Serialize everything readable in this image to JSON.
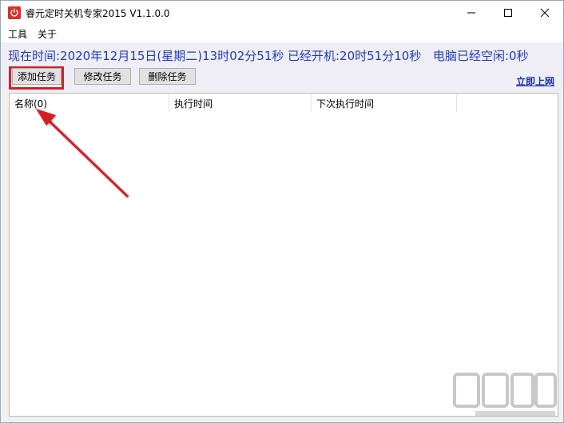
{
  "window": {
    "title": "睿元定时关机专家2015 V1.1.0.0",
    "controls": [
      "minimize-icon",
      "maximize-icon",
      "close-icon"
    ]
  },
  "menu": {
    "items": [
      {
        "label": "工具"
      },
      {
        "label": "关于"
      }
    ]
  },
  "status": {
    "current_time": "现在时间:2020年12月15日(星期二)13时02分51秒",
    "uptime": "已经开机:20时51分10秒",
    "idle": "电脑已经空闲:0秒"
  },
  "toolbar": {
    "add_label": "添加任务",
    "edit_label": "修改任务",
    "delete_label": "删除任务",
    "link_label": "立即上网"
  },
  "table": {
    "columns": [
      {
        "label": "名称(0)"
      },
      {
        "label": "执行时间"
      },
      {
        "label": "下次执行时间"
      },
      {
        "label": ""
      }
    ],
    "rows": []
  },
  "colors": {
    "info_text": "#1f3cc7",
    "highlight": "#d3212a",
    "app_icon": "#d9302a"
  }
}
